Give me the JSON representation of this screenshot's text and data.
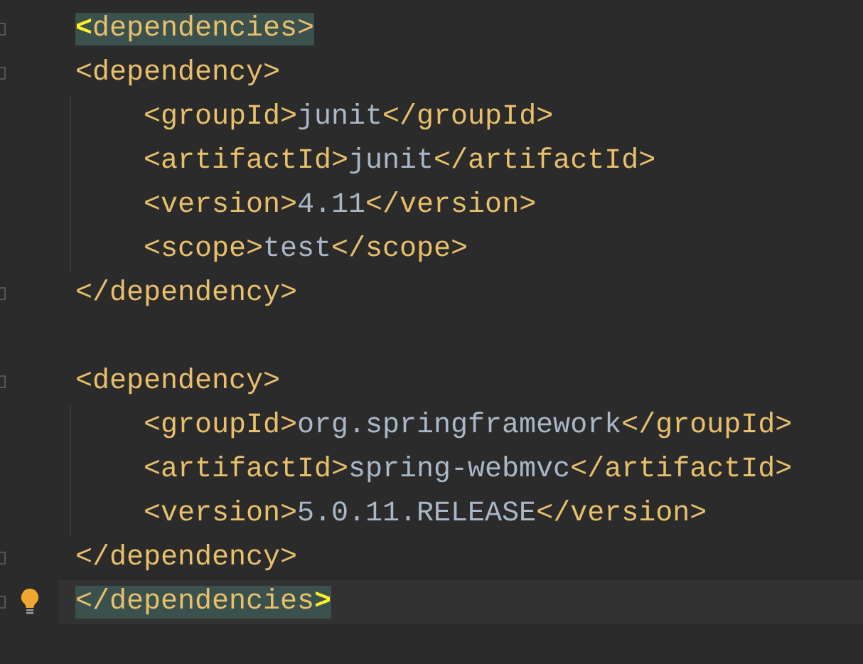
{
  "editor": {
    "lines": [
      {
        "kind": "code",
        "fold_marker": true,
        "current": false,
        "bulb": false,
        "tokens": [
          {
            "kind": "match",
            "text": "<"
          },
          {
            "kind": "tag_hl",
            "text": "dependencies>"
          }
        ]
      },
      {
        "kind": "code",
        "fold_marker": true,
        "current": false,
        "bulb": false,
        "tokens": [
          {
            "kind": "tag",
            "text": "<dependency>"
          }
        ],
        "children": [
          {
            "kind": "code",
            "fold_marker": false,
            "current": false,
            "bulb": false,
            "tokens": [
              {
                "kind": "tag",
                "text": "<groupId>"
              },
              {
                "kind": "value",
                "text": "junit"
              },
              {
                "kind": "tag",
                "text": "</groupId>"
              }
            ]
          },
          {
            "kind": "code",
            "fold_marker": false,
            "current": false,
            "bulb": false,
            "tokens": [
              {
                "kind": "tag",
                "text": "<artifactId>"
              },
              {
                "kind": "value",
                "text": "junit"
              },
              {
                "kind": "tag",
                "text": "</artifactId>"
              }
            ]
          },
          {
            "kind": "code",
            "fold_marker": false,
            "current": false,
            "bulb": false,
            "tokens": [
              {
                "kind": "tag",
                "text": "<version>"
              },
              {
                "kind": "value",
                "text": "4.11"
              },
              {
                "kind": "tag",
                "text": "</version>"
              }
            ]
          },
          {
            "kind": "code",
            "fold_marker": false,
            "current": false,
            "bulb": false,
            "tokens": [
              {
                "kind": "tag",
                "text": "<scope>"
              },
              {
                "kind": "value",
                "text": "test"
              },
              {
                "kind": "tag",
                "text": "</scope>"
              }
            ]
          }
        ]
      },
      {
        "kind": "code",
        "fold_marker": true,
        "current": false,
        "bulb": false,
        "tokens": [
          {
            "kind": "tag",
            "text": "</dependency>"
          }
        ]
      },
      {
        "kind": "blank"
      },
      {
        "kind": "code",
        "fold_marker": true,
        "current": false,
        "bulb": false,
        "tokens": [
          {
            "kind": "tag",
            "text": "<dependency>"
          }
        ],
        "children": [
          {
            "kind": "code",
            "fold_marker": false,
            "current": false,
            "bulb": false,
            "tokens": [
              {
                "kind": "tag",
                "text": "<groupId>"
              },
              {
                "kind": "value",
                "text": "org.springframework"
              },
              {
                "kind": "tag",
                "text": "</groupId>"
              }
            ]
          },
          {
            "kind": "code",
            "fold_marker": false,
            "current": false,
            "bulb": false,
            "tokens": [
              {
                "kind": "tag",
                "text": "<artifactId>"
              },
              {
                "kind": "value",
                "text": "spring-webmvc"
              },
              {
                "kind": "tag",
                "text": "</artifactId>"
              }
            ]
          },
          {
            "kind": "code",
            "fold_marker": false,
            "current": false,
            "bulb": false,
            "tokens": [
              {
                "kind": "tag",
                "text": "<version>"
              },
              {
                "kind": "value",
                "text": "5.0.11.RELEASE"
              },
              {
                "kind": "tag",
                "text": "</version>"
              }
            ]
          }
        ]
      },
      {
        "kind": "code",
        "fold_marker": true,
        "current": false,
        "bulb": false,
        "tokens": [
          {
            "kind": "tag",
            "text": "</dependency>"
          }
        ]
      },
      {
        "kind": "code",
        "fold_marker": true,
        "current": true,
        "bulb": true,
        "tokens": [
          {
            "kind": "tag_hl",
            "text": "</dependencies"
          },
          {
            "kind": "match",
            "text": ">"
          }
        ]
      }
    ]
  }
}
